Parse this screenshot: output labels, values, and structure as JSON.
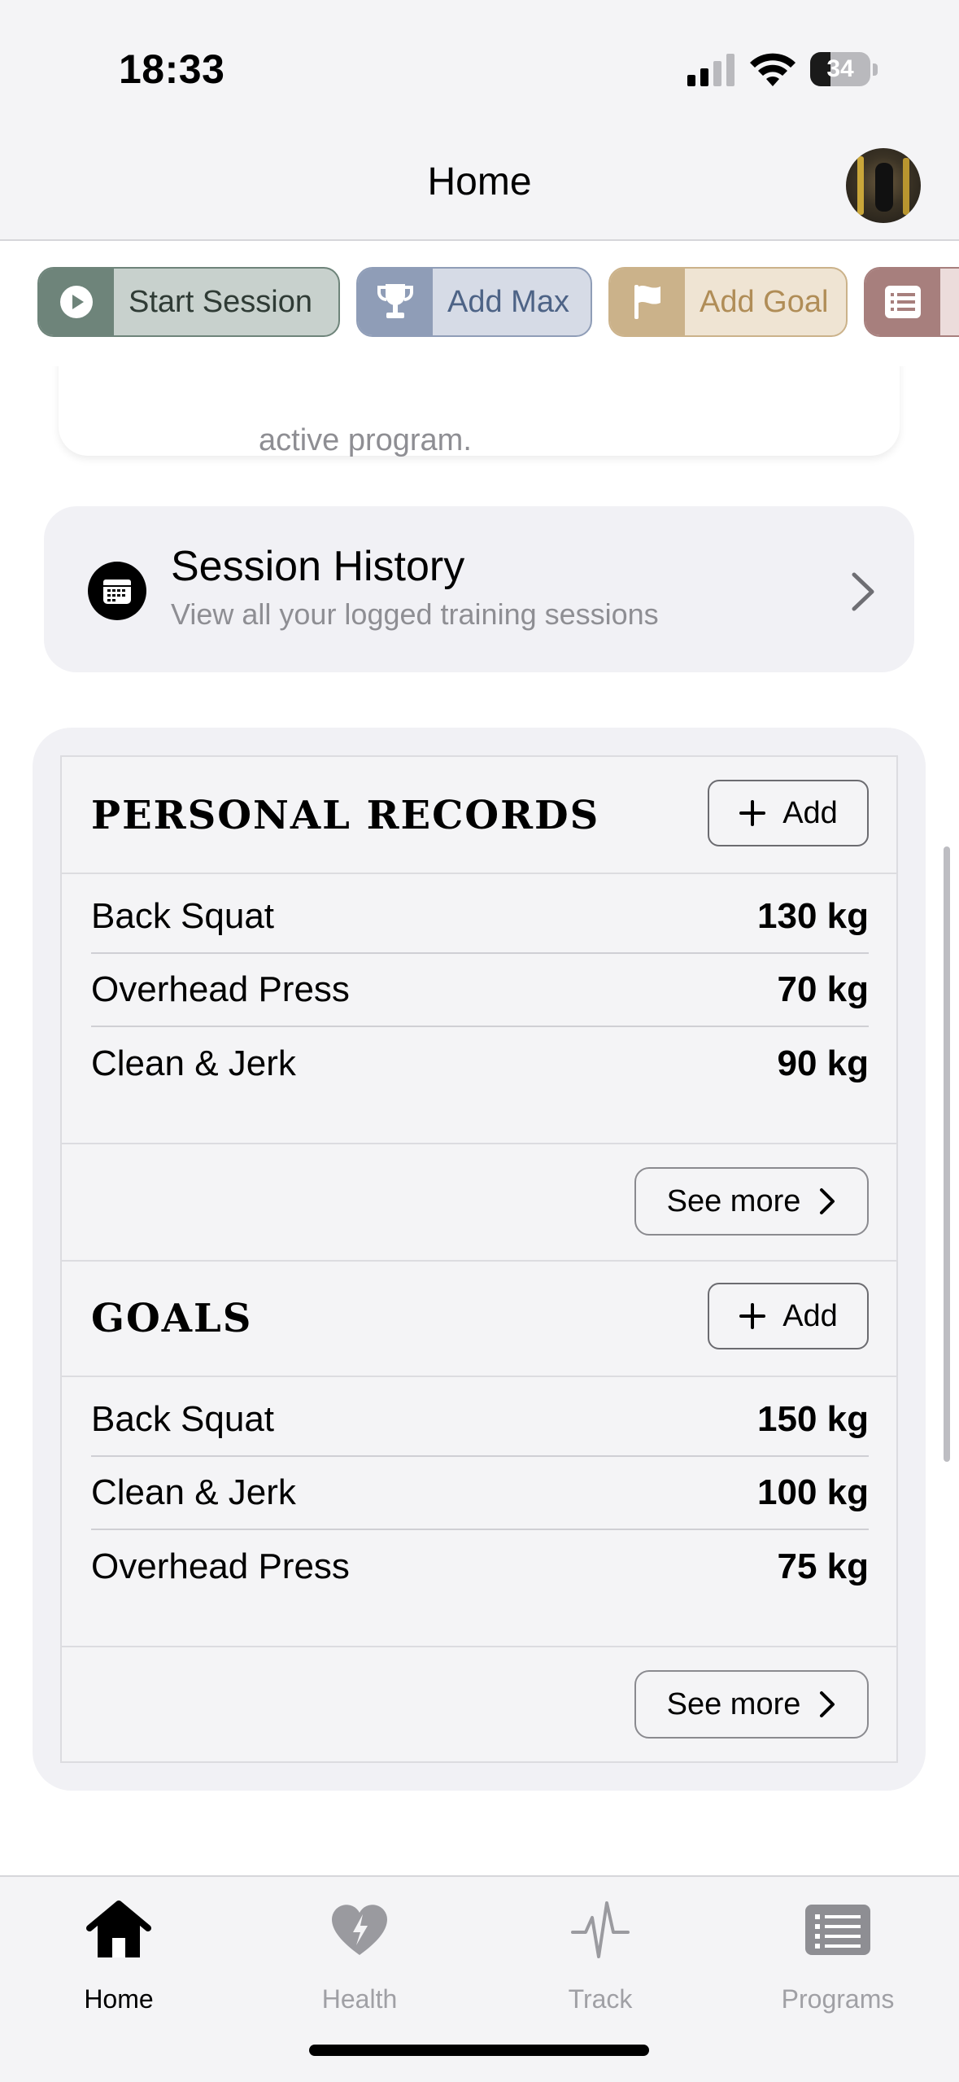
{
  "status_bar": {
    "time": "18:33",
    "battery_level": "34",
    "battery_fraction": 0.34,
    "icons": [
      "cellular-signal-icon",
      "wifi-icon",
      "battery-icon"
    ]
  },
  "nav": {
    "title": "Home",
    "avatar_icon": "profile-avatar"
  },
  "quick_actions": [
    {
      "label": "Start Session",
      "icon": "play-circle-icon",
      "accent": "#6e847a",
      "bg": "#c8d1cd",
      "text_color": "#2f3b35"
    },
    {
      "label": "Add Max",
      "icon": "trophy-icon",
      "accent": "#8f9db7",
      "bg": "#d6dbe6",
      "text_color": "#4d6386"
    },
    {
      "label": "Add Goal",
      "icon": "flag-icon",
      "accent": "#cbb28a",
      "bg": "#efe4d3",
      "text_color": "#b08d57"
    },
    {
      "label": "",
      "icon": "list-icon",
      "accent": "#a77f7d",
      "bg": "#ecdcdb",
      "text_color": "#7a4a48"
    }
  ],
  "program_card": {
    "text": "active program."
  },
  "session_history": {
    "title": "Session History",
    "subtitle": "View all your logged training sessions",
    "icon": "calendar-icon"
  },
  "personal_records": {
    "title": "PERSONAL RECORDS",
    "add_label": "Add",
    "see_more_label": "See more",
    "items": [
      {
        "name": "Back Squat",
        "value": "130 kg"
      },
      {
        "name": "Overhead Press",
        "value": "70 kg"
      },
      {
        "name": "Clean & Jerk",
        "value": "90 kg"
      }
    ]
  },
  "goals": {
    "title": "GOALS",
    "add_label": "Add",
    "see_more_label": "See more",
    "items": [
      {
        "name": "Back Squat",
        "value": "150 kg"
      },
      {
        "name": "Clean & Jerk",
        "value": "100 kg"
      },
      {
        "name": "Overhead Press",
        "value": "75 kg"
      }
    ]
  },
  "tab_bar": {
    "tabs": [
      {
        "label": "Home",
        "icon": "house-icon",
        "active": true
      },
      {
        "label": "Health",
        "icon": "heart-bolt-icon",
        "active": false
      },
      {
        "label": "Track",
        "icon": "waveform-icon",
        "active": false
      },
      {
        "label": "Programs",
        "icon": "list-icon",
        "active": false
      }
    ]
  }
}
